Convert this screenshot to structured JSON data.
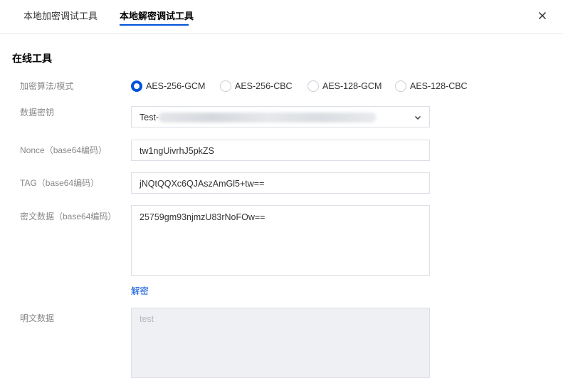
{
  "tabs": [
    {
      "label": "本地加密调试工具",
      "active": false
    },
    {
      "label": "本地解密调试工具",
      "active": true
    }
  ],
  "close_icon": "close-icon",
  "section_title": "在线工具",
  "labels": {
    "algorithm": "加密算法/模式",
    "key": "数据密钥",
    "nonce": "Nonce（base64编码）",
    "tag": "TAG（base64编码）",
    "ciphertext": "密文数据（base64编码）",
    "plaintext": "明文数据"
  },
  "algorithms": [
    {
      "label": "AES-256-GCM",
      "checked": true
    },
    {
      "label": "AES-256-CBC",
      "checked": false
    },
    {
      "label": "AES-128-GCM",
      "checked": false
    },
    {
      "label": "AES-128-CBC",
      "checked": false
    }
  ],
  "key_select": {
    "value": "Test-",
    "icon": "chevron-down-icon"
  },
  "nonce_value": "tw1ngUivrhJ5pkZS",
  "tag_value": "jNQtQQXc6QJAszAmGl5+tw==",
  "ciphertext_value": "25759gm93njmzU83rNoFOw==",
  "decrypt_label": "解密",
  "plaintext_value": "test",
  "colors": {
    "accent": "#0052d9",
    "label": "#888888",
    "border": "#dcdfe6",
    "disabled_bg": "#eef0f3"
  }
}
